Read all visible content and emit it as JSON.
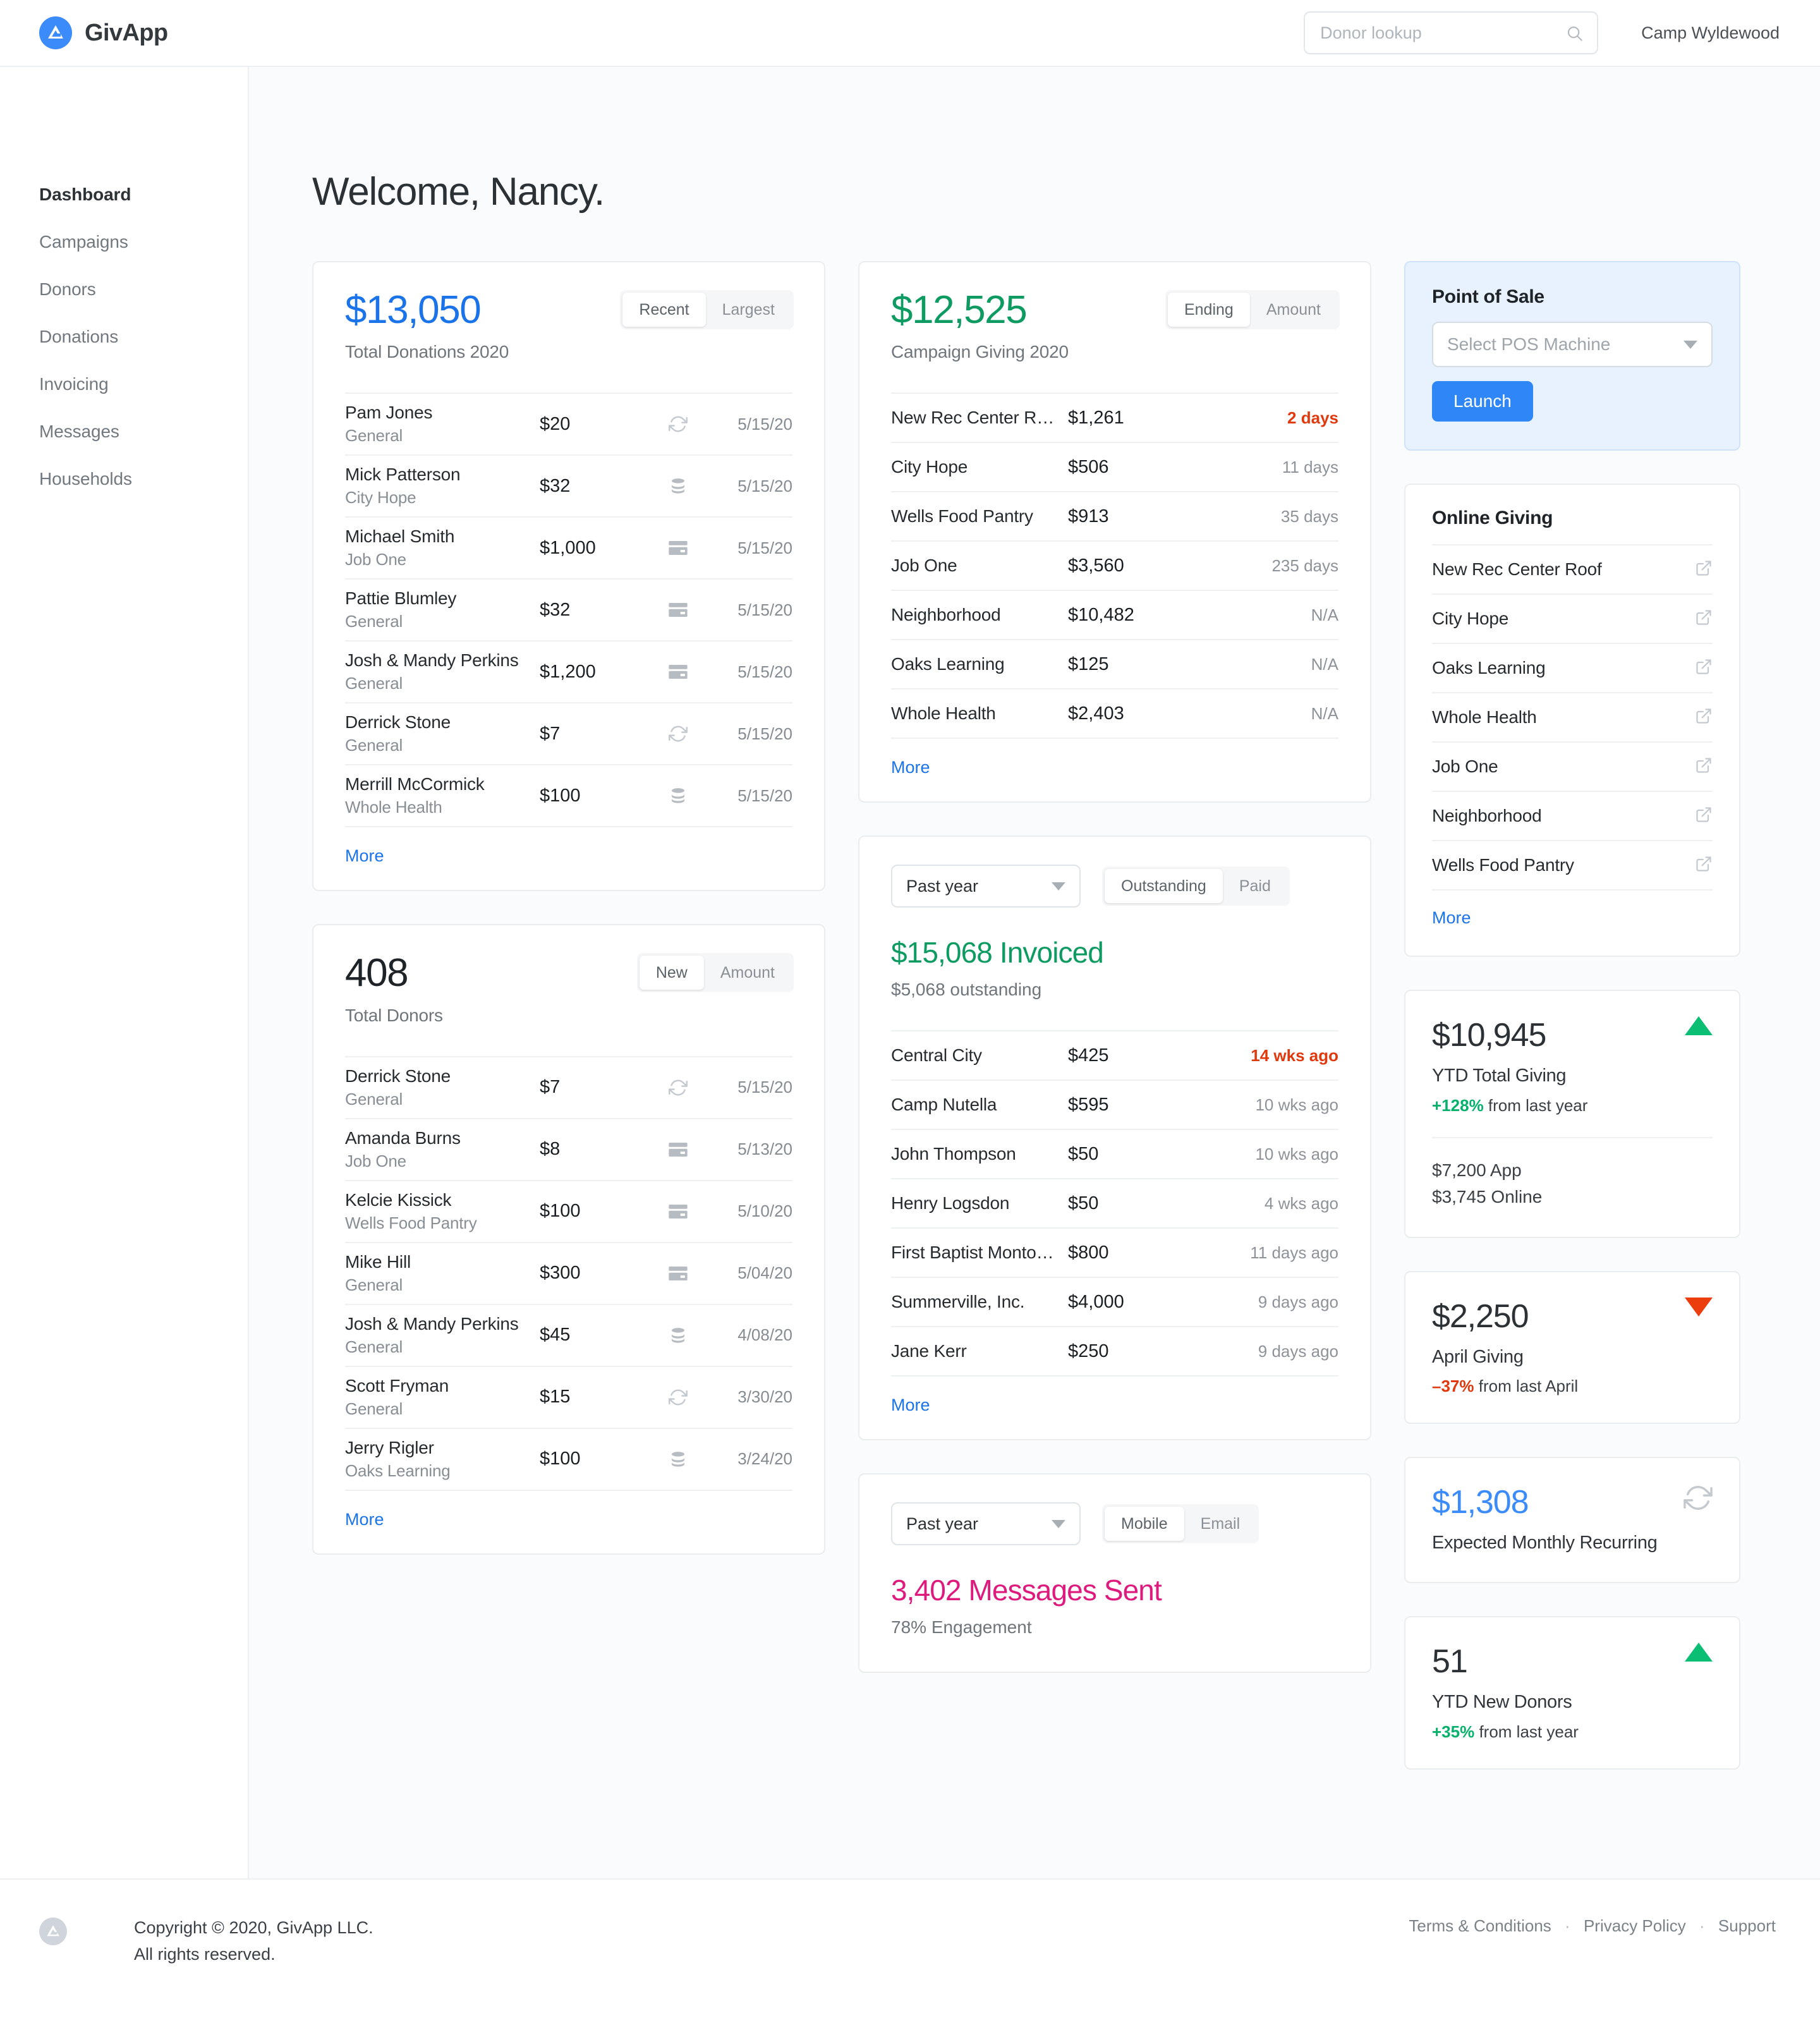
{
  "header": {
    "brand_name": "GivApp",
    "search": {
      "placeholder": "Donor lookup",
      "value": ""
    },
    "org_name": "Camp Wyldewood"
  },
  "sidebar": {
    "items": [
      {
        "label": "Dashboard",
        "active": true
      },
      {
        "label": "Campaigns",
        "active": false
      },
      {
        "label": "Donors",
        "active": false
      },
      {
        "label": "Donations",
        "active": false
      },
      {
        "label": "Invoicing",
        "active": false
      },
      {
        "label": "Messages",
        "active": false
      },
      {
        "label": "Households",
        "active": false
      }
    ]
  },
  "page": {
    "title": "Welcome, Nancy."
  },
  "donations_card": {
    "value": "$13,050",
    "label": "Total Donations 2020",
    "toggle": {
      "options": [
        "Recent",
        "Largest"
      ],
      "selected": "Recent"
    },
    "rows": [
      {
        "name": "Pam Jones",
        "fund": "General",
        "amount": "$20",
        "method": "recurring-icon",
        "date": "5/15/20"
      },
      {
        "name": "Mick Patterson",
        "fund": "City Hope",
        "amount": "$32",
        "method": "cash-icon",
        "date": "5/15/20"
      },
      {
        "name": "Michael Smith",
        "fund": "Job One",
        "amount": "$1,000",
        "method": "card-icon",
        "date": "5/15/20"
      },
      {
        "name": "Pattie Blumley",
        "fund": "General",
        "amount": "$32",
        "method": "card-icon",
        "date": "5/15/20"
      },
      {
        "name": "Josh & Mandy Perkins",
        "fund": "General",
        "amount": "$1,200",
        "method": "card-icon",
        "date": "5/15/20"
      },
      {
        "name": "Derrick Stone",
        "fund": "General",
        "amount": "$7",
        "method": "recurring-icon",
        "date": "5/15/20"
      },
      {
        "name": "Merrill McCormick",
        "fund": "Whole Health",
        "amount": "$100",
        "method": "cash-icon",
        "date": "5/15/20"
      }
    ],
    "more_label": "More"
  },
  "donors_card": {
    "value": "408",
    "label": "Total Donors",
    "toggle": {
      "options": [
        "New",
        "Amount"
      ],
      "selected": "New"
    },
    "rows": [
      {
        "name": "Derrick Stone",
        "fund": "General",
        "amount": "$7",
        "method": "recurring-icon",
        "date": "5/15/20"
      },
      {
        "name": "Amanda Burns",
        "fund": "Job One",
        "amount": "$8",
        "method": "card-icon",
        "date": "5/13/20"
      },
      {
        "name": "Kelcie Kissick",
        "fund": "Wells Food Pantry",
        "amount": "$100",
        "method": "card-icon",
        "date": "5/10/20"
      },
      {
        "name": "Mike Hill",
        "fund": "General",
        "amount": "$300",
        "method": "card-icon",
        "date": "5/04/20"
      },
      {
        "name": "Josh & Mandy Perkins",
        "fund": "General",
        "amount": "$45",
        "method": "cash-icon",
        "date": "4/08/20"
      },
      {
        "name": "Scott Fryman",
        "fund": "General",
        "amount": "$15",
        "method": "recurring-icon",
        "date": "3/30/20"
      },
      {
        "name": "Jerry Rigler",
        "fund": "Oaks Learning",
        "amount": "$100",
        "method": "cash-icon",
        "date": "3/24/20"
      }
    ],
    "more_label": "More"
  },
  "campaigns_card": {
    "value": "$12,525",
    "label": "Campaign Giving 2020",
    "toggle": {
      "options": [
        "Ending",
        "Amount"
      ],
      "selected": "Ending"
    },
    "rows": [
      {
        "name": "New Rec Center Roof",
        "amount": "$1,261",
        "meta": "2 days",
        "alert": true
      },
      {
        "name": "City Hope",
        "amount": "$506",
        "meta": "11 days",
        "alert": false
      },
      {
        "name": "Wells Food Pantry",
        "amount": "$913",
        "meta": "35 days",
        "alert": false
      },
      {
        "name": "Job One",
        "amount": "$3,560",
        "meta": "235 days",
        "alert": false
      },
      {
        "name": "Neighborhood",
        "amount": "$10,482",
        "meta": "N/A",
        "alert": false
      },
      {
        "name": "Oaks Learning",
        "amount": "$125",
        "meta": "N/A",
        "alert": false
      },
      {
        "name": "Whole Health",
        "amount": "$2,403",
        "meta": "N/A",
        "alert": false
      }
    ],
    "more_label": "More"
  },
  "invoicing_card": {
    "period_select": "Past year",
    "toggle": {
      "options": [
        "Outstanding",
        "Paid"
      ],
      "selected": "Outstanding"
    },
    "headline": "$15,068 Invoiced",
    "subline": "$5,068 outstanding",
    "rows": [
      {
        "name": "Central City",
        "amount": "$425",
        "meta": "14 wks ago",
        "alert": true
      },
      {
        "name": "Camp Nutella",
        "amount": "$595",
        "meta": "10 wks ago",
        "alert": false
      },
      {
        "name": "John Thompson",
        "amount": "$50",
        "meta": "10 wks ago",
        "alert": false
      },
      {
        "name": "Henry Logsdon",
        "amount": "$50",
        "meta": "4 wks ago",
        "alert": false
      },
      {
        "name": "First Baptist Montogm…",
        "amount": "$800",
        "meta": "11 days ago",
        "alert": false
      },
      {
        "name": "Summerville, Inc.",
        "amount": "$4,000",
        "meta": "9 days ago",
        "alert": false
      },
      {
        "name": "Jane Kerr",
        "amount": "$250",
        "meta": "9 days ago",
        "alert": false
      }
    ],
    "more_label": "More"
  },
  "messages_card": {
    "period_select": "Past year",
    "toggle": {
      "options": [
        "Mobile",
        "Email"
      ],
      "selected": "Mobile"
    },
    "headline": "3,402 Messages Sent",
    "subline": "78% Engagement"
  },
  "pos_card": {
    "title": "Point of Sale",
    "select_placeholder": "Select POS Machine",
    "launch_label": "Launch"
  },
  "online_giving_card": {
    "title": "Online Giving",
    "items": [
      "New Rec Center Roof",
      "City Hope",
      "Oaks Learning",
      "Whole Health",
      "Job One",
      "Neighborhood",
      "Wells Food Pantry"
    ],
    "more_label": "More"
  },
  "kpi_ytd_giving": {
    "value": "$10,945",
    "label": "YTD Total Giving",
    "delta": "+128%",
    "delta_suffix": " from last year",
    "direction": "up",
    "split_app": "$7,200 App",
    "split_online": "$3,745 Online"
  },
  "kpi_april": {
    "value": "$2,250",
    "label": "April Giving",
    "delta": "–37%",
    "delta_suffix": " from last April",
    "direction": "down"
  },
  "kpi_recurring": {
    "value": "$1,308",
    "label": "Expected Monthly Recurring"
  },
  "kpi_new_donors": {
    "value": "51",
    "label": "YTD New Donors",
    "delta": "+35%",
    "delta_suffix": " from last year",
    "direction": "up"
  },
  "footer": {
    "copyright_line1": "Copyright © 2020, GivApp LLC.",
    "copyright_line2": "All rights reserved.",
    "links": [
      "Terms & Conditions",
      "Privacy Policy",
      "Support"
    ]
  },
  "colors": {
    "accent_blue": "#1a73e8",
    "green": "#0d9b62",
    "pink": "#de1a7d",
    "alert_orange": "#e0390e",
    "up_green": "#0cbd74",
    "down_red": "#ec3e0c"
  }
}
